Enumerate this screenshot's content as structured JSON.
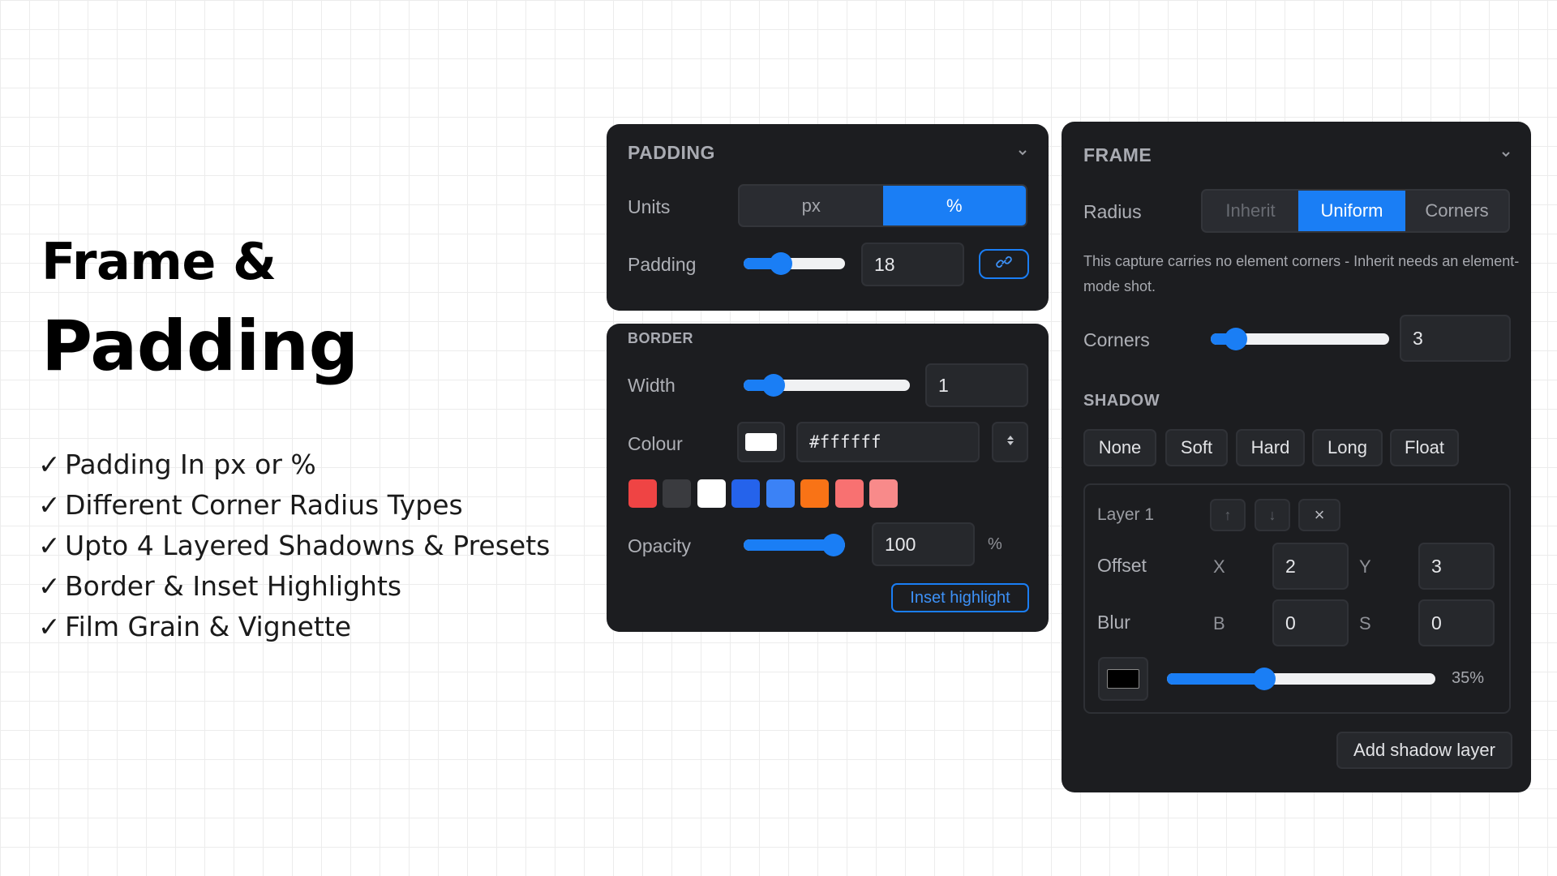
{
  "hero": {
    "title_line1": "Frame &",
    "title_line2": "Padding",
    "check": "✓",
    "features": [
      "Padding In px or %",
      "Different Corner Radius Types",
      "Upto 4 Layered Shadowns & Presets",
      "Border & Inset Highlights",
      "Film Grain & Vignette"
    ]
  },
  "padding_panel": {
    "title": "PADDING",
    "units_label": "Units",
    "units_options": [
      "px",
      "%"
    ],
    "units_selected": "%",
    "padding_label": "Padding",
    "padding_value": "18",
    "padding_slider_fraction": 0.33,
    "link_icon": "link-icon"
  },
  "border_panel": {
    "title": "BORDER",
    "width_label": "Width",
    "width_value": "1",
    "width_slider_fraction": 0.13,
    "colour_label": "Colour",
    "colour_value": "#ffffff",
    "swatches": [
      "#ef4444",
      "#3a3b3f",
      "#ffffff",
      "#2563eb",
      "#3b82f6",
      "#f97316",
      "#f87171",
      "#f88a8a"
    ],
    "opacity_label": "Opacity",
    "opacity_value": "100",
    "opacity_unit": "%",
    "opacity_slider_fraction": 1.0,
    "inset_label": "Inset highlight"
  },
  "frame_panel": {
    "title": "FRAME",
    "radius_label": "Radius",
    "radius_options": [
      "Inherit",
      "Uniform",
      "Corners"
    ],
    "radius_selected": "Uniform",
    "hint": "This capture carries no element corners - Inherit needs an element-mode shot.",
    "corners_label": "Corners",
    "corners_value": "3",
    "corners_slider_fraction": 0.09,
    "shadow_title": "SHADOW",
    "presets": [
      "None",
      "Soft",
      "Hard",
      "Long",
      "Float"
    ],
    "layer": {
      "name": "Layer 1",
      "up": "↑",
      "down": "↓",
      "remove": "×",
      "offset_label": "Offset",
      "x_label": "X",
      "x_value": "2",
      "y_label": "Y",
      "y_value": "3",
      "blur_label": "Blur",
      "b_label": "B",
      "b_value": "0",
      "s_label": "S",
      "s_value": "0",
      "shadow_colour": "#000000",
      "opacity_slider_fraction": 0.35,
      "opacity_text": "35%"
    },
    "add_label": "Add shadow layer"
  },
  "accent_color": "#1a7ef5"
}
